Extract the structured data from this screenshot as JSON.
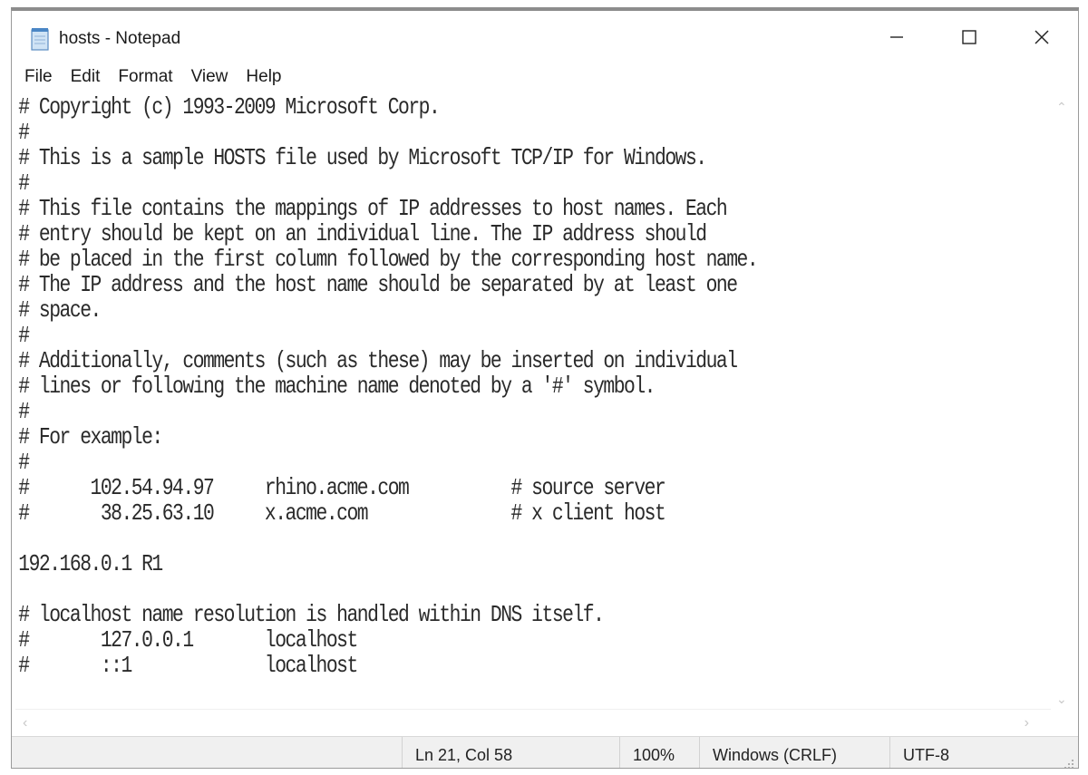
{
  "window": {
    "title": "hosts - Notepad",
    "app_icon": "notepad-icon",
    "controls": {
      "minimize_icon": "minimize-icon",
      "maximize_icon": "maximize-icon",
      "close_icon": "close-icon"
    }
  },
  "menu": [
    "File",
    "Edit",
    "Format",
    "View",
    "Help"
  ],
  "editor": {
    "content": "# Copyright (c) 1993-2009 Microsoft Corp.\n#\n# This is a sample HOSTS file used by Microsoft TCP/IP for Windows.\n#\n# This file contains the mappings of IP addresses to host names. Each\n# entry should be kept on an individual line. The IP address should\n# be placed in the first column followed by the corresponding host name.\n# The IP address and the host name should be separated by at least one\n# space.\n#\n# Additionally, comments (such as these) may be inserted on individual\n# lines or following the machine name denoted by a '#' symbol.\n#\n# For example:\n#\n#      102.54.94.97     rhino.acme.com          # source server\n#       38.25.63.10     x.acme.com              # x client host\n\n192.168.0.1 R1\n\n# localhost name resolution is handled within DNS itself.\n#\t127.0.0.1       localhost\n#\t::1             localhost"
  },
  "statusbar": {
    "position": "Ln 21, Col 58",
    "zoom": "100%",
    "line_ending": "Windows (CRLF)",
    "encoding": "UTF-8"
  }
}
